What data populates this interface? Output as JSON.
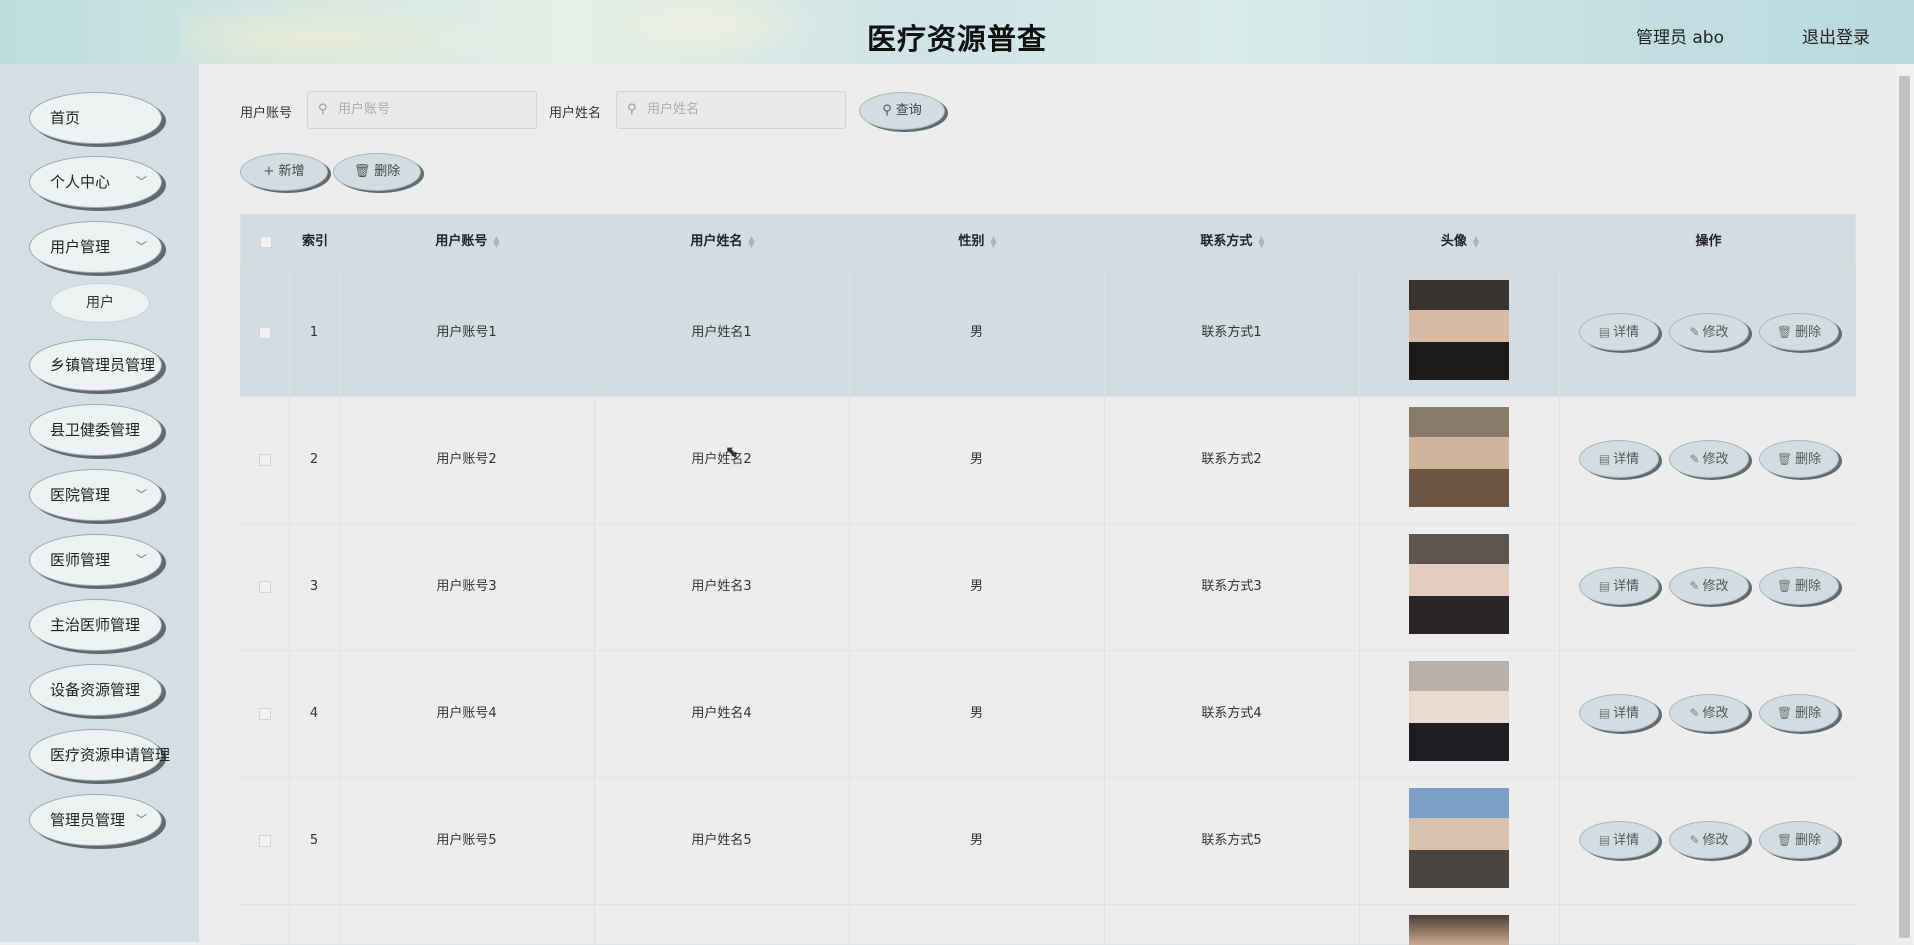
{
  "header": {
    "title": "医疗资源普查",
    "admin": "管理员 abo",
    "logout": "退出登录"
  },
  "sidebar": {
    "items": [
      {
        "label": "首页",
        "has_children": false
      },
      {
        "label": "个人中心",
        "has_children": true
      },
      {
        "label": "用户管理",
        "has_children": true
      },
      {
        "label": "乡镇管理员管理",
        "has_children": true
      },
      {
        "label": "县卫健委管理",
        "has_children": true
      },
      {
        "label": "医院管理",
        "has_children": true
      },
      {
        "label": "医师管理",
        "has_children": true
      },
      {
        "label": "主治医师管理",
        "has_children": true
      },
      {
        "label": "设备资源管理",
        "has_children": true
      },
      {
        "label": "医疗资源申请管理",
        "has_children": true
      },
      {
        "label": "管理员管理",
        "has_children": true
      }
    ],
    "expanded_sub": "用户"
  },
  "search": {
    "account_label": "用户账号",
    "account_placeholder": "用户账号",
    "name_label": "用户姓名",
    "name_placeholder": "用户姓名",
    "query_button": "查询"
  },
  "actions": {
    "add": "新增",
    "delete": "删除"
  },
  "table": {
    "columns": {
      "index": "索引",
      "account": "用户账号",
      "name": "用户姓名",
      "gender": "性别",
      "contact": "联系方式",
      "avatar": "头像",
      "ops": "操作"
    },
    "row_buttons": {
      "detail": "详情",
      "edit": "修改",
      "delete": "删除"
    },
    "rows": [
      {
        "index": "1",
        "account": "用户账号1",
        "name": "用户姓名1",
        "gender": "男",
        "contact": "联系方式1"
      },
      {
        "index": "2",
        "account": "用户账号2",
        "name": "用户姓名2",
        "gender": "男",
        "contact": "联系方式2"
      },
      {
        "index": "3",
        "account": "用户账号3",
        "name": "用户姓名3",
        "gender": "男",
        "contact": "联系方式3"
      },
      {
        "index": "4",
        "account": "用户账号4",
        "name": "用户姓名4",
        "gender": "男",
        "contact": "联系方式4"
      },
      {
        "index": "5",
        "account": "用户账号5",
        "name": "用户姓名5",
        "gender": "男",
        "contact": "联系方式5"
      }
    ]
  },
  "colors": {
    "sidebar_bg": "#d3dfe3",
    "table_header_bg": "#d1dde1",
    "button_shadow": "#5f6b6e"
  }
}
